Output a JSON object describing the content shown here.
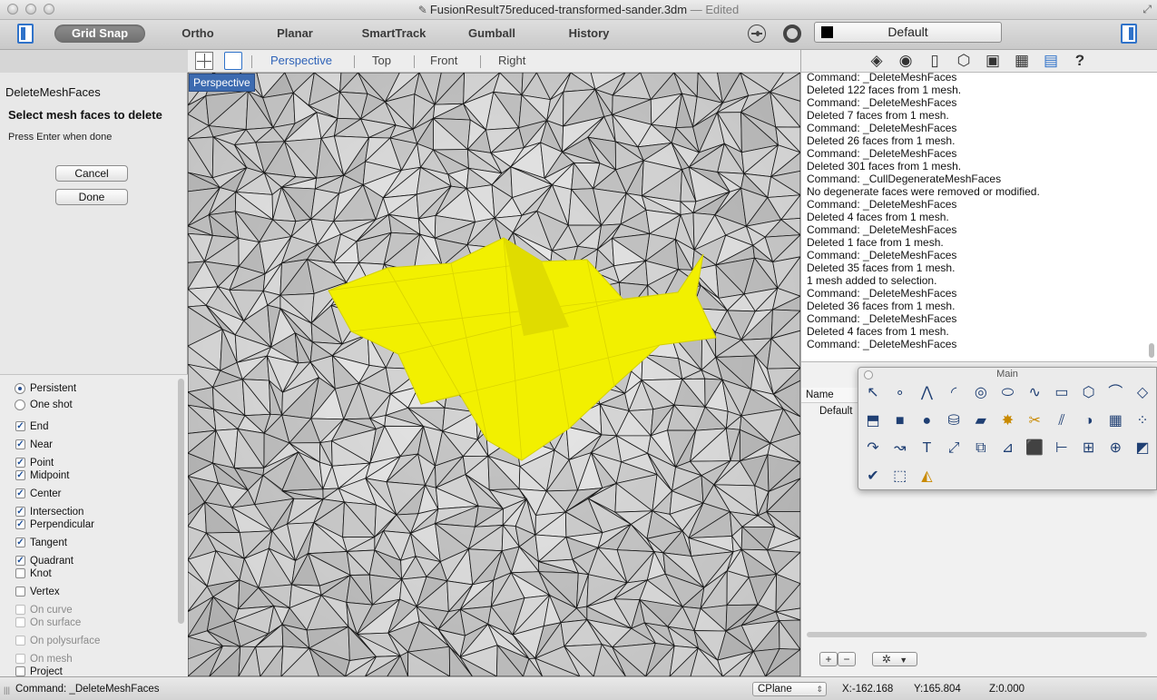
{
  "window": {
    "title": "FusionResult75reduced-transformed-sander.3dm",
    "edited": "— Edited"
  },
  "toolbar": {
    "grid_snap": "Grid Snap",
    "ortho": "Ortho",
    "planar": "Planar",
    "smarttrack": "SmartTrack",
    "gumball": "Gumball",
    "history": "History",
    "layer_name": "Default"
  },
  "viewport_tabs": [
    "Perspective",
    "Top",
    "Front",
    "Right"
  ],
  "viewport": {
    "label": "Perspective",
    "highlight_color": "#f2f000"
  },
  "command_panel": {
    "name": "DeleteMeshFaces",
    "prompt": "Select mesh faces to delete",
    "hint": "Press Enter when done",
    "cancel": "Cancel",
    "done": "Done"
  },
  "osnap": {
    "mode": [
      {
        "label": "Persistent",
        "selected": true
      },
      {
        "label": "One shot",
        "selected": false
      }
    ],
    "items": [
      {
        "label": "End",
        "checked": true,
        "enabled": true
      },
      {
        "label": "Near",
        "checked": true,
        "enabled": true
      },
      {
        "label": "Point",
        "checked": true,
        "enabled": true
      },
      {
        "label": "Midpoint",
        "checked": true,
        "enabled": true
      },
      {
        "label": "Center",
        "checked": true,
        "enabled": true
      },
      {
        "label": "Intersection",
        "checked": true,
        "enabled": true
      },
      {
        "label": "Perpendicular",
        "checked": true,
        "enabled": true
      },
      {
        "label": "Tangent",
        "checked": true,
        "enabled": true
      },
      {
        "label": "Quadrant",
        "checked": true,
        "enabled": true
      },
      {
        "label": "Knot",
        "checked": false,
        "enabled": true
      },
      {
        "label": "Vertex",
        "checked": false,
        "enabled": true
      },
      {
        "label": "On curve",
        "checked": false,
        "enabled": false
      },
      {
        "label": "On surface",
        "checked": false,
        "enabled": false
      },
      {
        "label": "On polysurface",
        "checked": false,
        "enabled": false
      },
      {
        "label": "On mesh",
        "checked": false,
        "enabled": false
      },
      {
        "label": "Project",
        "checked": false,
        "enabled": true
      }
    ]
  },
  "command_history": [
    "Command:  _DeleteMeshFaces",
    "Deleted 122 faces from 1 mesh.",
    "Command:  _DeleteMeshFaces",
    "Deleted 7 faces from 1 mesh.",
    "Command:  _DeleteMeshFaces",
    "Deleted 26 faces from 1 mesh.",
    "Command:  _DeleteMeshFaces",
    "Deleted 301 faces from 1 mesh.",
    "Command:  _CullDegenerateMeshFaces",
    "No degenerate faces were removed or modified.",
    "Command:  _DeleteMeshFaces",
    "Deleted 4 faces from 1 mesh.",
    "Command:  _DeleteMeshFaces",
    "Deleted 1 face from 1 mesh.",
    "Command:  _DeleteMeshFaces",
    "Deleted 35 faces from 1 mesh.",
    "1 mesh added to selection.",
    "Command:  _DeleteMeshFaces",
    "Deleted 36 faces from 1 mesh.",
    "Command:  _DeleteMeshFaces",
    "Deleted 4 faces from 1 mesh.",
    "Command:  _DeleteMeshFaces"
  ],
  "layers": {
    "column_name": "Name",
    "rows": [
      "Default"
    ],
    "add": "+",
    "remove": "−"
  },
  "palette": {
    "title": "Main",
    "tools": [
      "select-arrow-icon",
      "point-icon",
      "polyline-icon",
      "arc-icon",
      "circle-icon",
      "ellipse-icon",
      "curve-icon",
      "rectangle-icon",
      "polygon-icon",
      "fillet-icon",
      "surface-icon",
      "extrude-icon",
      "box-icon",
      "sphere-icon",
      "cylinder-icon",
      "plane-surface-icon",
      "explode-icon",
      "trim-icon",
      "split-icon",
      "boolean-icon",
      "mesh-icon",
      "points-icon",
      "offset-icon",
      "curve-tools-icon",
      "text-icon",
      "transform-icon",
      "array-icon",
      "scale-icon",
      "solid-tools-icon",
      "dimension-icon",
      "grid-array-icon",
      "analyze-icon",
      "render-icon",
      "check-icon",
      "bounding-box-icon",
      "paint-icon"
    ]
  },
  "status": {
    "command": "Command:  _DeleteMeshFaces",
    "cplane": "CPlane",
    "x": "X:-162.168",
    "y": "Y:165.804",
    "z": "Z:0.000"
  }
}
